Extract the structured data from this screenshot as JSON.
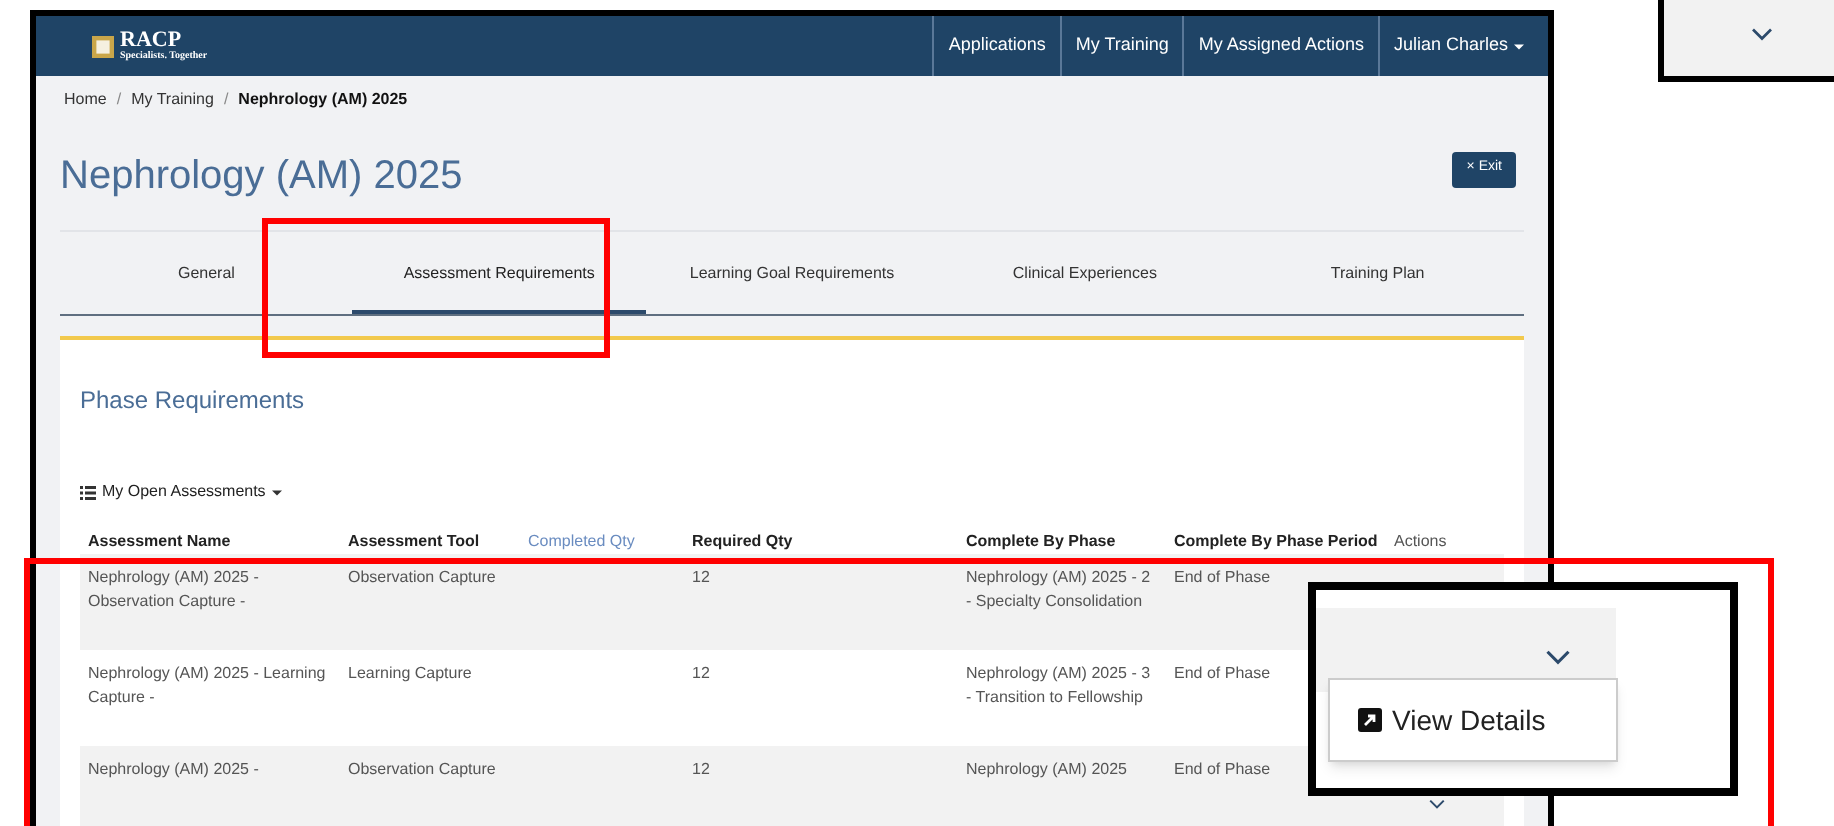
{
  "navbar": {
    "logo_title": "RACP",
    "logo_tagline": "Specialists. Together",
    "items": [
      "Applications",
      "My Training",
      "My Assigned Actions"
    ],
    "user": "Julian Charles"
  },
  "breadcrumb": {
    "separator": "/",
    "items": [
      {
        "label": "Home",
        "current": false
      },
      {
        "label": "My Training",
        "current": false
      },
      {
        "label": "Nephrology (AM) 2025",
        "current": true
      }
    ]
  },
  "page_title": "Nephrology (AM) 2025",
  "exit_button": {
    "icon": "×",
    "label": "Exit"
  },
  "tabs": [
    {
      "label": "General",
      "selected": false
    },
    {
      "label": "Assessment Requirements",
      "selected": true
    },
    {
      "label": "Learning Goal Requirements",
      "selected": false
    },
    {
      "label": "Clinical Experiences",
      "selected": false
    },
    {
      "label": "Training Plan",
      "selected": false
    }
  ],
  "section_title": "Phase Requirements",
  "filter_dropdown": "My Open Assessments",
  "table": {
    "columns": [
      {
        "label": "Assessment Name",
        "sortable": false
      },
      {
        "label": "Assessment Tool",
        "sortable": false
      },
      {
        "label": "Completed Qty",
        "sortable": true
      },
      {
        "label": "Required Qty",
        "sortable": false
      },
      {
        "label": "Complete By Phase",
        "sortable": false
      },
      {
        "label": "Complete By Phase Period",
        "sortable": false
      },
      {
        "label": "Actions",
        "sortable": false
      }
    ],
    "rows": [
      {
        "name": "Nephrology (AM) 2025 - Observation Capture -",
        "tool": "Observation Capture",
        "required": "12",
        "phase": "Nephrology (AM) 2025 - 2 - Specialty Consolidation",
        "period": "End of Phase"
      },
      {
        "name": "Nephrology (AM) 2025 - Learning Capture -",
        "tool": "Learning Capture",
        "required": "12",
        "phase": "Nephrology (AM) 2025 - 3 - Transition to Fellowship",
        "period": "End of Phase"
      },
      {
        "name": "Nephrology (AM) 2025 -",
        "tool": "Observation Capture",
        "required": "12",
        "phase": "Nephrology (AM) 2025",
        "period": "End of Phase"
      }
    ]
  },
  "callout": {
    "menu_items": [
      "View Details"
    ]
  }
}
